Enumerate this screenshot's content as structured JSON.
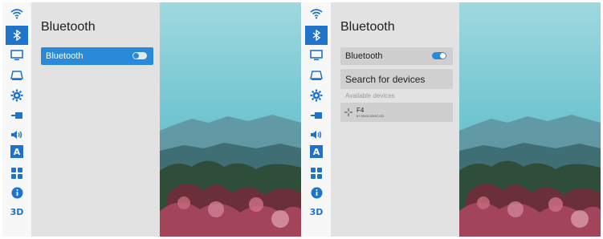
{
  "left_screen": {
    "title": "Bluetooth",
    "bluetooth_row": {
      "label": "Bluetooth",
      "toggle_state": "off"
    }
  },
  "right_screen": {
    "title": "Bluetooth",
    "bluetooth_row": {
      "label": "Bluetooth",
      "toggle_state": "on"
    },
    "search_label": "Search for devices",
    "available_label": "Available devices",
    "devices": [
      {
        "name": "F4",
        "address": "67:33:01:33:9C:CD",
        "icon": "gamepad-icon"
      }
    ]
  },
  "rail": {
    "items": [
      {
        "icon": "wifi-icon"
      },
      {
        "icon": "bluetooth-icon",
        "active": true
      },
      {
        "icon": "monitor-icon"
      },
      {
        "icon": "projector-icon"
      },
      {
        "icon": "gear-icon"
      },
      {
        "icon": "input-source-icon"
      },
      {
        "icon": "volume-icon"
      },
      {
        "icon": "language-icon",
        "text": "A"
      },
      {
        "icon": "apps-icon"
      },
      {
        "icon": "info-icon"
      },
      {
        "icon": "3d-icon",
        "text": "3D"
      }
    ]
  },
  "colors": {
    "accent": "#1f73c9",
    "selected_row": "#2a8ad9"
  }
}
